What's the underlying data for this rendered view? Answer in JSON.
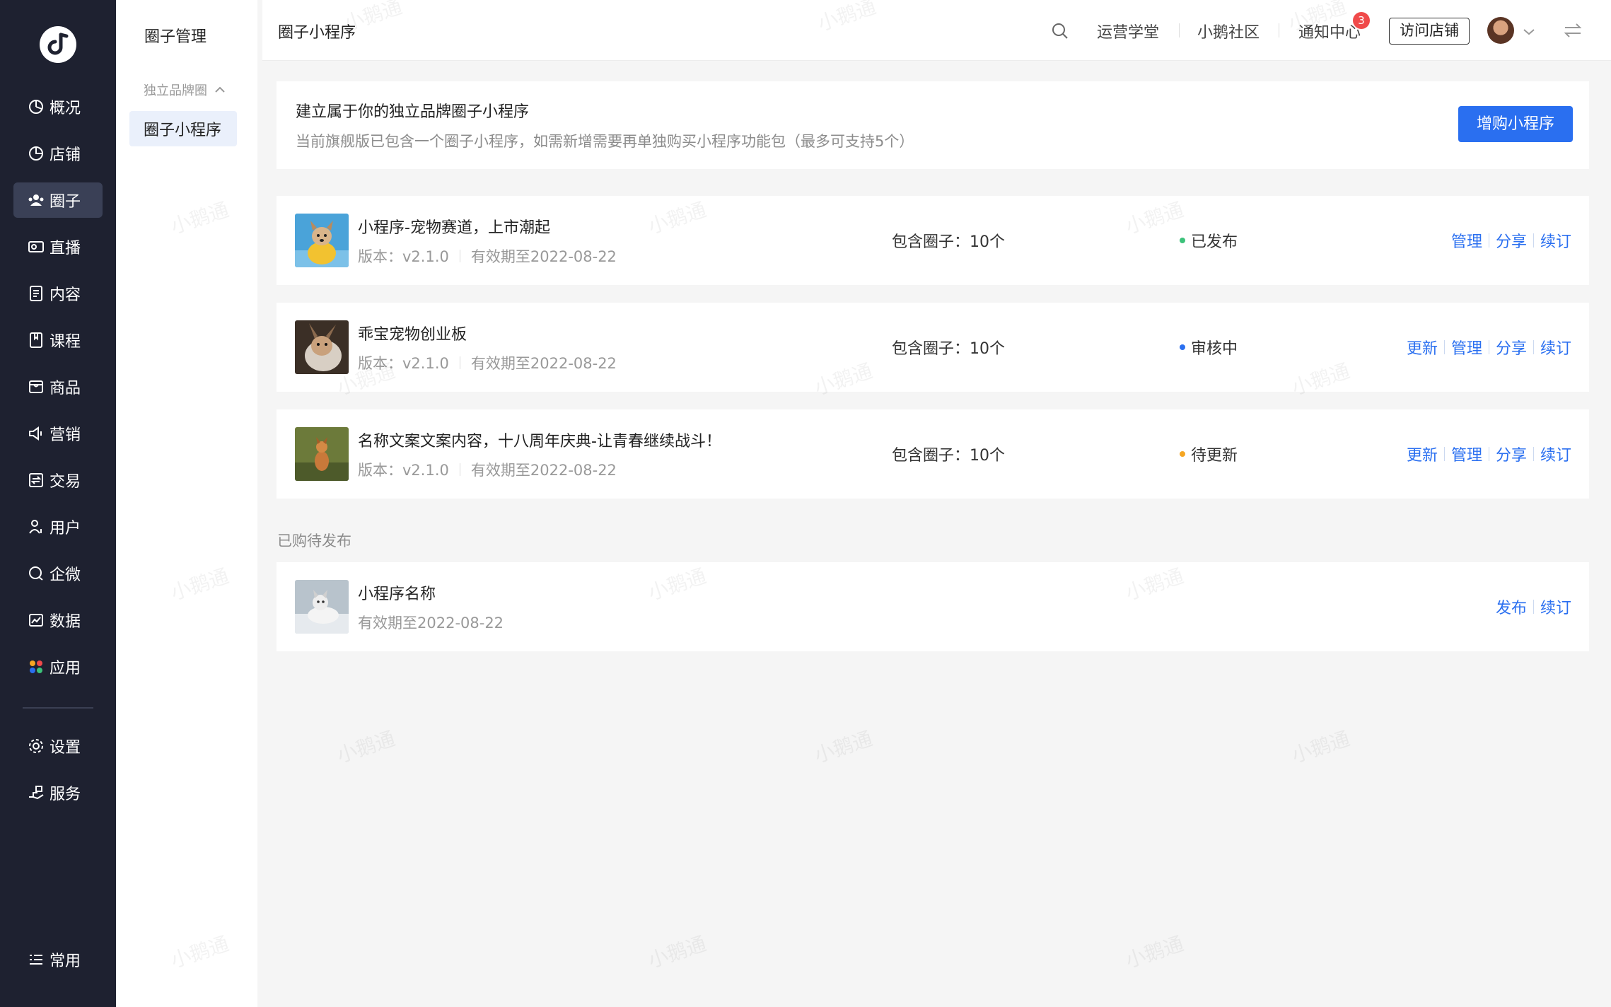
{
  "nav": {
    "items": [
      {
        "label": "概况",
        "icon": "overview-icon"
      },
      {
        "label": "店铺",
        "icon": "store-icon"
      },
      {
        "label": "圈子",
        "icon": "community-icon",
        "active": true
      },
      {
        "label": "直播",
        "icon": "live-icon"
      },
      {
        "label": "内容",
        "icon": "content-icon"
      },
      {
        "label": "课程",
        "icon": "course-icon"
      },
      {
        "label": "商品",
        "icon": "goods-icon"
      },
      {
        "label": "营销",
        "icon": "marketing-icon"
      },
      {
        "label": "交易",
        "icon": "trade-icon"
      },
      {
        "label": "用户",
        "icon": "user-icon"
      },
      {
        "label": "企微",
        "icon": "wecom-icon"
      },
      {
        "label": "数据",
        "icon": "data-icon"
      },
      {
        "label": "应用",
        "icon": "apps-icon"
      }
    ],
    "settings": "设置",
    "service": "服务",
    "common": "常用"
  },
  "subnav": {
    "title": "圈子管理",
    "group": "独立品牌圈",
    "item": "圈子小程序"
  },
  "header": {
    "title": "圈子小程序",
    "links": [
      "运营学堂",
      "小鹅社区",
      "通知中心"
    ],
    "notification_count": "3",
    "visit_store": "访问店铺"
  },
  "banner": {
    "title": "建立属于你的独立品牌圈子小程序",
    "desc": "当前旗舰版已包含一个圈子小程序，如需新增需要再单独购买小程序功能包（最多可支持5个）",
    "button": "增购小程序"
  },
  "published": [
    {
      "name": "小程序-宠物赛道，上市潮起",
      "version": "版本：v2.1.0",
      "expiry": "有效期至2022-08-22",
      "count": "包含圈子：10个",
      "status": "已发布",
      "status_color": "#3cc27a",
      "actions": [
        "管理",
        "分享",
        "续订"
      ]
    },
    {
      "name": "乖宝宠物创业板",
      "version": "版本：v2.1.0",
      "expiry": "有效期至2022-08-22",
      "count": "包含圈子：10个",
      "status": "审核中",
      "status_color": "#2a6ff0",
      "actions": [
        "更新",
        "管理",
        "分享",
        "续订"
      ]
    },
    {
      "name": "名称文案文案内容，十八周年庆典-让青春继续战斗！",
      "version": "版本：v2.1.0",
      "expiry": "有效期至2022-08-22",
      "count": "包含圈子：10个",
      "status": "待更新",
      "status_color": "#f5a623",
      "actions": [
        "更新",
        "管理",
        "分享",
        "续订"
      ]
    }
  ],
  "pending": {
    "label": "已购待发布",
    "item": {
      "name": "小程序名称",
      "expiry": "有效期至2022-08-22",
      "actions": [
        "发布",
        "续订"
      ]
    }
  },
  "watermark": "小鹅通",
  "colors": {
    "primary": "#2a6ff0",
    "sidebar": "#1e2130"
  }
}
